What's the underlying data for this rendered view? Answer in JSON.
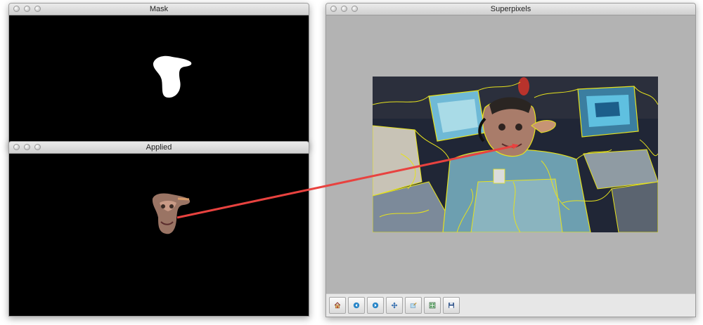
{
  "windows": {
    "mask": {
      "title": "Mask"
    },
    "applied": {
      "title": "Applied"
    },
    "superpixels": {
      "title": "Superpixels"
    }
  },
  "toolbar": {
    "tools": [
      {
        "name": "home-icon"
      },
      {
        "name": "back-arrow-icon"
      },
      {
        "name": "forward-arrow-icon"
      },
      {
        "name": "pan-icon"
      },
      {
        "name": "zoom-rect-icon"
      },
      {
        "name": "subplots-config-icon"
      },
      {
        "name": "save-floppy-icon"
      }
    ]
  },
  "colors": {
    "arrow": "#e8423f",
    "superpixel_boundary": "#e6e21e",
    "viewer_background": "#b3b3b3"
  }
}
